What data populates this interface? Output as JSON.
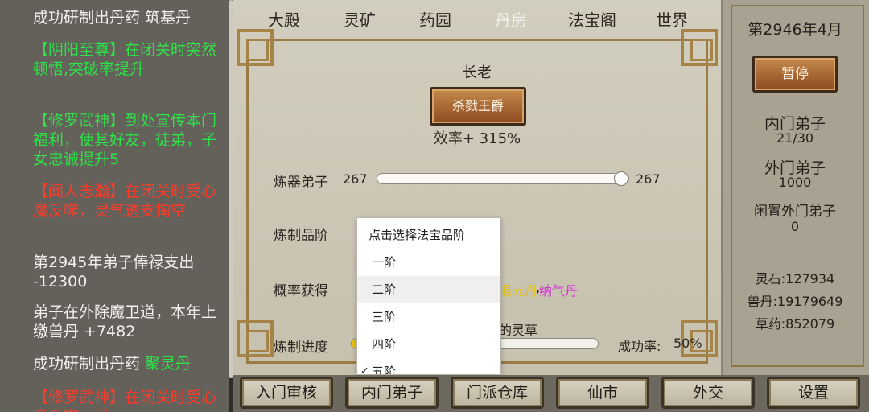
{
  "log": {
    "entries": [
      {
        "color": "white",
        "text": "成功研制出丹药 筑基丹"
      },
      {
        "color": "green",
        "text": "【阴阳至尊】在闭关时突然顿悟,突破率提升"
      },
      {
        "color": "green",
        "text": "【修罗武神】到处宣传本门福利，使其好友，徒弟，子女忠诚提升5"
      },
      {
        "color": "red",
        "text": "【闻人志瀚】在闭关时受心魔反噬，灵气透支掏空"
      },
      {
        "color": "white",
        "text": "第2945年弟子俸禄支出 -12300"
      },
      {
        "color": "white",
        "text": "弟子在外除魔卫道，本年上缴兽丹 +7482"
      },
      {
        "color": "white",
        "text": "成功研制出丹药 ",
        "highlight": "聚灵丹"
      },
      {
        "color": "red",
        "text": "【修罗武神】在闭关时受心魔反噬，灵"
      }
    ]
  },
  "tabs": [
    "大殿",
    "灵矿",
    "药园",
    "丹房",
    "法宝阁",
    "世界"
  ],
  "active_tab": "丹房",
  "alchemy": {
    "elder_label": "长老",
    "elder_name": "杀戮王爵",
    "efficiency": "效率+ 315%",
    "disciples_label": "炼器弟子",
    "disciples_min": "267",
    "disciples_max": "267",
    "disciples_fraction": 1.0,
    "grade_label": "炼制品阶",
    "prob_label": "概率获得",
    "prob_item_yellow": "混元丹",
    "prob_sep": ",",
    "prob_item_magenta": "纳气丹",
    "herb_text": "的灵草",
    "progress_label": "炼制进度",
    "progress_fraction": 0.02,
    "success_label": "成功率:",
    "success_value": "50%"
  },
  "dropdown": {
    "header": "点击选择法宝品阶",
    "items": [
      "一阶",
      "二阶",
      "三阶",
      "四阶",
      "五阶"
    ],
    "highlighted": "二阶",
    "checked": "五阶"
  },
  "right": {
    "date": "第2946年4月",
    "pause_label": "暂停",
    "inner_title": "内门弟子",
    "inner_count": "21/30",
    "outer_title": "外门弟子",
    "outer_count": "1000",
    "idle_title": "闲置外门弟子",
    "idle_count": "0",
    "stone": "灵石:127934",
    "pill": "兽丹:19179649",
    "herb": "草药:852079"
  },
  "bottom": [
    "入门审核",
    "内门弟子",
    "门派仓库",
    "仙市",
    "外交",
    "设置"
  ],
  "colors": {
    "green": "#2fe24a",
    "red": "#ff3b2a",
    "yellow": "#e0c21a",
    "magenta": "#d630d8",
    "button_brown": "#8e4a20"
  }
}
